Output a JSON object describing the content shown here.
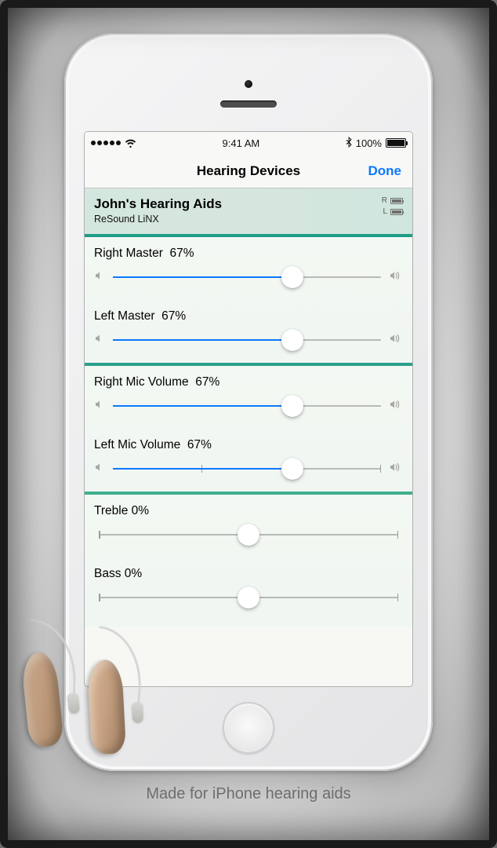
{
  "statusbar": {
    "time": "9:41 AM",
    "battery_pct": "100%"
  },
  "navbar": {
    "title": "Hearing Devices",
    "done": "Done"
  },
  "device": {
    "name": "John's Hearing Aids",
    "model": "ReSound LiNX",
    "right_label": "R",
    "left_label": "L",
    "right_batt_pct": 90,
    "left_batt_pct": 90
  },
  "sliders": [
    {
      "label": "Right Master",
      "value_text": "67%",
      "value": 67,
      "kind": "volume"
    },
    {
      "label": "Left Master",
      "value_text": "67%",
      "value": 67,
      "kind": "volume"
    },
    {
      "label": "Right Mic Volume",
      "value_text": "67%",
      "value": 67,
      "kind": "volume"
    },
    {
      "label": "Left Mic Volume",
      "value_text": "67%",
      "value": 67,
      "kind": "volume"
    },
    {
      "label": "Treble",
      "value_text": "0%",
      "value": 50,
      "kind": "tone"
    },
    {
      "label": "Bass",
      "value_text": "0%",
      "value": 50,
      "kind": "tone"
    }
  ],
  "caption": "Made for iPhone hearing aids"
}
